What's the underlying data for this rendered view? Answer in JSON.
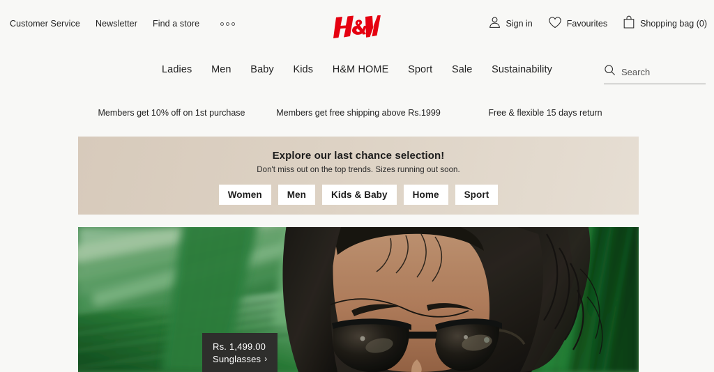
{
  "topbar": {
    "links": [
      {
        "label": "Customer Service",
        "name": "customer-service-link"
      },
      {
        "label": "Newsletter",
        "name": "newsletter-link"
      },
      {
        "label": "Find a store",
        "name": "find-a-store-link"
      }
    ],
    "more_icon": "more-dots-icon",
    "logo_alt": "H&M",
    "logo_color": "#e50010",
    "account": {
      "label": "Sign in",
      "icon": "person-icon"
    },
    "favourites": {
      "label": "Favourites",
      "icon": "heart-icon"
    },
    "bag": {
      "label": "Shopping bag (0)",
      "icon": "shopping-bag-icon",
      "count": 0
    }
  },
  "mainnav": {
    "items": [
      {
        "label": "Ladies"
      },
      {
        "label": "Men"
      },
      {
        "label": "Baby"
      },
      {
        "label": "Kids"
      },
      {
        "label": "H&M HOME"
      },
      {
        "label": "Sport"
      },
      {
        "label": "Sale"
      },
      {
        "label": "Sustainability"
      }
    ]
  },
  "search": {
    "placeholder": "Search",
    "value": "",
    "icon": "search-icon"
  },
  "benefits": [
    {
      "text": "Members get 10% off on 1st purchase"
    },
    {
      "text": "Members get free shipping above Rs.1999"
    },
    {
      "text": "Free & flexible 15 days return"
    }
  ],
  "promo": {
    "title": "Explore our last chance selection!",
    "subtitle": "Don't miss out on the top trends. Sizes running out soon.",
    "background_start": "#d7cabb",
    "background_end": "#e6ded3",
    "buttons": [
      {
        "label": "Women"
      },
      {
        "label": "Men"
      },
      {
        "label": "Kids & Baby"
      },
      {
        "label": "Home"
      },
      {
        "label": "Sport"
      }
    ]
  },
  "hero": {
    "alt": "Model with wet hair wearing dark sunglasses in front of green palm leaves",
    "tag": {
      "price": "Rs. 1,499.00",
      "product": "Sunglasses",
      "chevron": "›"
    }
  }
}
